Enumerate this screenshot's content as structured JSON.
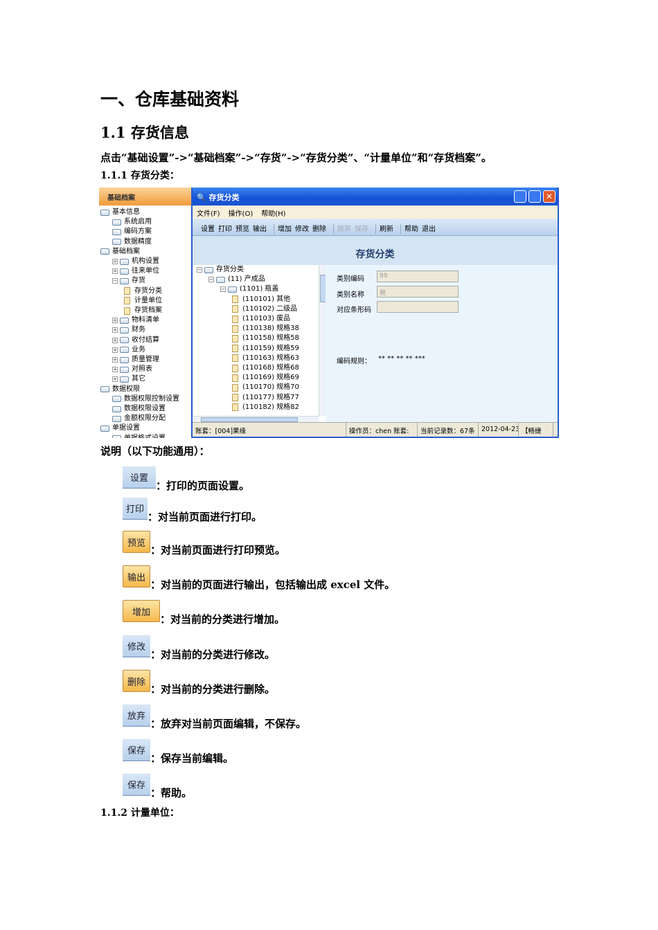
{
  "doc": {
    "h1": "一、仓库基础资料",
    "h2": "1.1 存货信息",
    "path": "点击“基础设置”->“基础档案”->“存货”->“存货分类”、“计量单位”和“存货档案”。",
    "h3_1": "1.1.1 存货分类：",
    "note": "说明（以下功能通用）：",
    "h3_2": "1.1.2 计量单位："
  },
  "left_panel": {
    "title": "基础档案",
    "items": [
      {
        "label": "基本信息",
        "level": 0,
        "type": "folder",
        "toggle": ""
      },
      {
        "label": "系统启用",
        "level": 1,
        "type": "folder",
        "toggle": ""
      },
      {
        "label": "编码方案",
        "level": 1,
        "type": "folder",
        "toggle": ""
      },
      {
        "label": "数据精度",
        "level": 1,
        "type": "folder",
        "toggle": ""
      },
      {
        "label": "基础档案",
        "level": 0,
        "type": "folder",
        "toggle": ""
      },
      {
        "label": "机构设置",
        "level": 1,
        "type": "folder",
        "toggle": "+"
      },
      {
        "label": "往来单位",
        "level": 1,
        "type": "folder",
        "toggle": "+"
      },
      {
        "label": "存货",
        "level": 1,
        "type": "folder",
        "toggle": "-"
      },
      {
        "label": "存货分类",
        "level": 2,
        "type": "doc",
        "toggle": ""
      },
      {
        "label": "计量单位",
        "level": 2,
        "type": "doc",
        "toggle": ""
      },
      {
        "label": "存货档案",
        "level": 2,
        "type": "doc",
        "toggle": ""
      },
      {
        "label": "物料清单",
        "level": 1,
        "type": "folder",
        "toggle": "+"
      },
      {
        "label": "财务",
        "level": 1,
        "type": "folder",
        "toggle": "+"
      },
      {
        "label": "收付结算",
        "level": 1,
        "type": "folder",
        "toggle": "+"
      },
      {
        "label": "业务",
        "level": 1,
        "type": "folder",
        "toggle": "+"
      },
      {
        "label": "质量管理",
        "level": 1,
        "type": "folder",
        "toggle": "+"
      },
      {
        "label": "对照表",
        "level": 1,
        "type": "folder",
        "toggle": "+"
      },
      {
        "label": "其它",
        "level": 1,
        "type": "folder",
        "toggle": "+"
      },
      {
        "label": "数据权限",
        "level": 0,
        "type": "folder",
        "toggle": ""
      },
      {
        "label": "数据权限控制设置",
        "level": 1,
        "type": "folder",
        "toggle": ""
      },
      {
        "label": "数据权限设置",
        "level": 1,
        "type": "folder",
        "toggle": ""
      },
      {
        "label": "金额权限分配",
        "level": 1,
        "type": "folder",
        "toggle": ""
      },
      {
        "label": "单据设置",
        "level": 0,
        "type": "folder",
        "toggle": ""
      },
      {
        "label": "单据格式设置",
        "level": 1,
        "type": "folder",
        "toggle": ""
      }
    ]
  },
  "window": {
    "title": "存货分类",
    "menu": [
      "文件(F)",
      "操作(O)",
      "帮助(H)"
    ],
    "toolbar": [
      {
        "label": "设置",
        "enabled": true
      },
      {
        "label": "打印",
        "enabled": true
      },
      {
        "label": "预览",
        "enabled": true
      },
      {
        "label": "输出",
        "enabled": true
      },
      {
        "sep": true
      },
      {
        "label": "增加",
        "enabled": true
      },
      {
        "label": "修改",
        "enabled": true
      },
      {
        "label": "删除",
        "enabled": true
      },
      {
        "sep": true
      },
      {
        "label": "放弃",
        "enabled": false
      },
      {
        "label": "保存",
        "enabled": false
      },
      {
        "sep": true
      },
      {
        "label": "刷新",
        "enabled": true
      },
      {
        "sep": true
      },
      {
        "label": "帮助",
        "enabled": true
      },
      {
        "label": "退出",
        "enabled": true
      }
    ],
    "heading": "存货分类",
    "tree": [
      {
        "label": "存货分类",
        "level": 0,
        "type": "folder",
        "toggle": "-"
      },
      {
        "label": "(11) 产成品",
        "level": 1,
        "type": "folder",
        "toggle": "-"
      },
      {
        "label": "(1101) 瓶盖",
        "level": 2,
        "type": "folder",
        "toggle": "-"
      },
      {
        "label": "(110101) 其他",
        "level": 3,
        "type": "doc",
        "toggle": ""
      },
      {
        "label": "(110102) 二级品",
        "level": 3,
        "type": "doc",
        "toggle": ""
      },
      {
        "label": "(110103) 废品",
        "level": 3,
        "type": "doc",
        "toggle": ""
      },
      {
        "label": "(110138) 规格38",
        "level": 3,
        "type": "doc",
        "toggle": ""
      },
      {
        "label": "(110158) 规格58",
        "level": 3,
        "type": "doc",
        "toggle": ""
      },
      {
        "label": "(110159) 规格59",
        "level": 3,
        "type": "doc",
        "toggle": ""
      },
      {
        "label": "(110163) 规格63",
        "level": 3,
        "type": "doc",
        "toggle": ""
      },
      {
        "label": "(110168) 规格68",
        "level": 3,
        "type": "doc",
        "toggle": ""
      },
      {
        "label": "(110169) 规格69",
        "level": 3,
        "type": "doc",
        "toggle": ""
      },
      {
        "label": "(110170) 规格70",
        "level": 3,
        "type": "doc",
        "toggle": ""
      },
      {
        "label": "(110177) 规格77",
        "level": 3,
        "type": "doc",
        "toggle": ""
      },
      {
        "label": "(110182) 规格82",
        "level": 3,
        "type": "doc",
        "toggle": ""
      }
    ],
    "form": {
      "code_label": "类别编码",
      "code_value": "99",
      "name_label": "类别名称",
      "name_value": "税",
      "barcode_label": "对应条形码",
      "barcode_value": "",
      "rule_label": "编码规则：",
      "rule_value": "** ** ** ** ***"
    },
    "status": [
      "账套：[004]果缘",
      "操作员：chen 账套:",
      "当前记录数：67条",
      "2012-04-23",
      "【畅捷"
    ]
  },
  "buttons": [
    {
      "label": "设置",
      "desc": "：打印的页面设置。",
      "style": "blue"
    },
    {
      "label": "打印",
      "desc": "：对当前页面进行打印。",
      "style": "blue"
    },
    {
      "label": "预览",
      "desc": "：对当前页面进行打印预览。",
      "style": "orange"
    },
    {
      "label": "输出",
      "desc": "：对当前的页面进行输出，包括输出成 excel 文件。",
      "style": "orange"
    },
    {
      "label": "增加",
      "desc": "：对当前的分类进行增加。",
      "style": "orange"
    },
    {
      "label": "修改",
      "desc": "：对当前的分类进行修改。",
      "style": "blue"
    },
    {
      "label": "删除",
      "desc": "：对当前的分类进行删除。",
      "style": "orange"
    },
    {
      "label": "放弃",
      "desc": "：放弃对当前页面编辑，不保存。",
      "style": "blue"
    },
    {
      "label": "保存",
      "desc": "：保存当前编辑。",
      "style": "blue"
    },
    {
      "label": "保存",
      "desc": "：帮助。",
      "style": "blue"
    }
  ]
}
